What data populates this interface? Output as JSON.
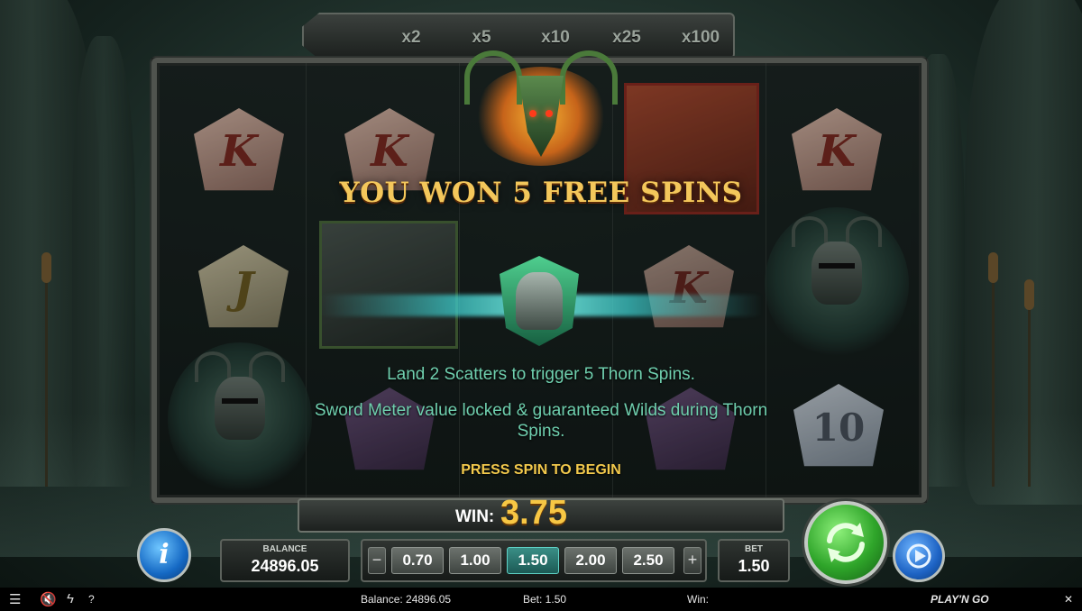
{
  "meter": {
    "multipliers": [
      "x2",
      "x5",
      "x10",
      "x25",
      "x100"
    ]
  },
  "reels": {
    "row1": {
      "r1": "K",
      "r2": "K",
      "r5": "K"
    },
    "row2": {
      "r1": "J",
      "r4": "K"
    },
    "row3": {
      "r5": "10"
    }
  },
  "popup": {
    "title": "YOU WON 5 FREE SPINS",
    "line1": "Land 2 Scatters to trigger 5 Thorn Spins.",
    "line2": "Sword Meter value locked & guaranteed Wilds during Thorn Spins.",
    "cta": "PRESS SPIN TO BEGIN"
  },
  "win": {
    "label": "WIN:",
    "value": "3.75"
  },
  "balance": {
    "label": "BALANCE",
    "value": "24896.05"
  },
  "bet": {
    "label": "BET",
    "value": "1.50",
    "options": [
      "0.70",
      "1.00",
      "1.50",
      "2.00",
      "2.50"
    ],
    "selected_index": 2,
    "minus": "−",
    "plus": "+"
  },
  "info_button": "i",
  "status_bar": {
    "balance_text": "Balance: 24896.05",
    "bet_text": "Bet: 1.50",
    "win_text": "Win:",
    "brand": "PLAY'N GO",
    "help": "?",
    "close": "✕",
    "menu_icon": "menu-icon",
    "sound_icon": "mute-icon",
    "turbo_icon": "lightning-icon"
  },
  "colors": {
    "gold": "#f3c75b",
    "teal_text": "#6fcfae",
    "spin_green": "#2fa52a",
    "selected_bet": "#3a8e86"
  }
}
